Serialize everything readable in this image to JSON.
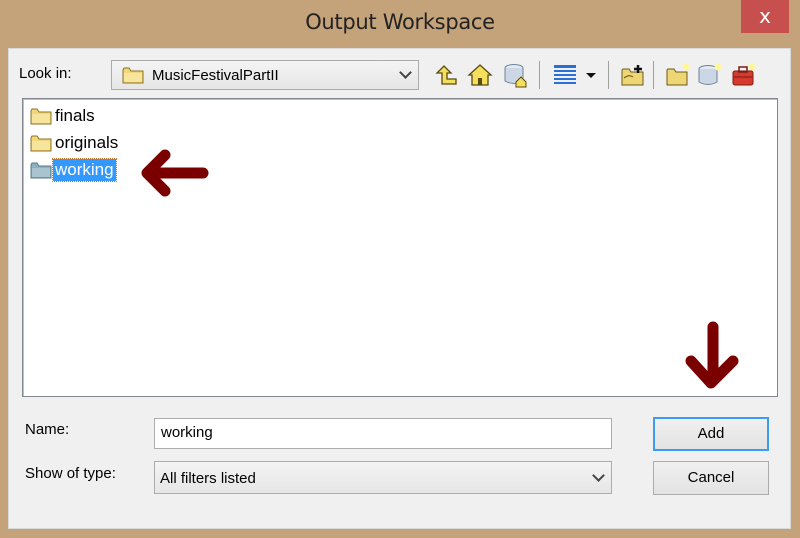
{
  "window": {
    "title": "Output Workspace",
    "close_label": "x"
  },
  "look_in": {
    "label": "Look in:",
    "value": "MusicFestivalPartII"
  },
  "toolbar": {
    "icons": [
      "up-one-level-icon",
      "home-icon",
      "default-geodatabase-icon",
      "list-view-icon",
      "view-menu-dropdown-icon",
      "connect-to-folder-icon",
      "new-folder-icon",
      "new-file-geodatabase-icon",
      "new-toolbox-icon"
    ]
  },
  "file_list": {
    "items": [
      {
        "name": "finals",
        "selected": false
      },
      {
        "name": "originals",
        "selected": false
      },
      {
        "name": "working",
        "selected": true
      }
    ]
  },
  "name_field": {
    "label": "Name:",
    "value": "working"
  },
  "type_field": {
    "label": "Show of type:",
    "value": "All filters listed"
  },
  "buttons": {
    "add": "Add",
    "cancel": "Cancel"
  },
  "annotations": {
    "arrow_color": "#7a0000"
  }
}
